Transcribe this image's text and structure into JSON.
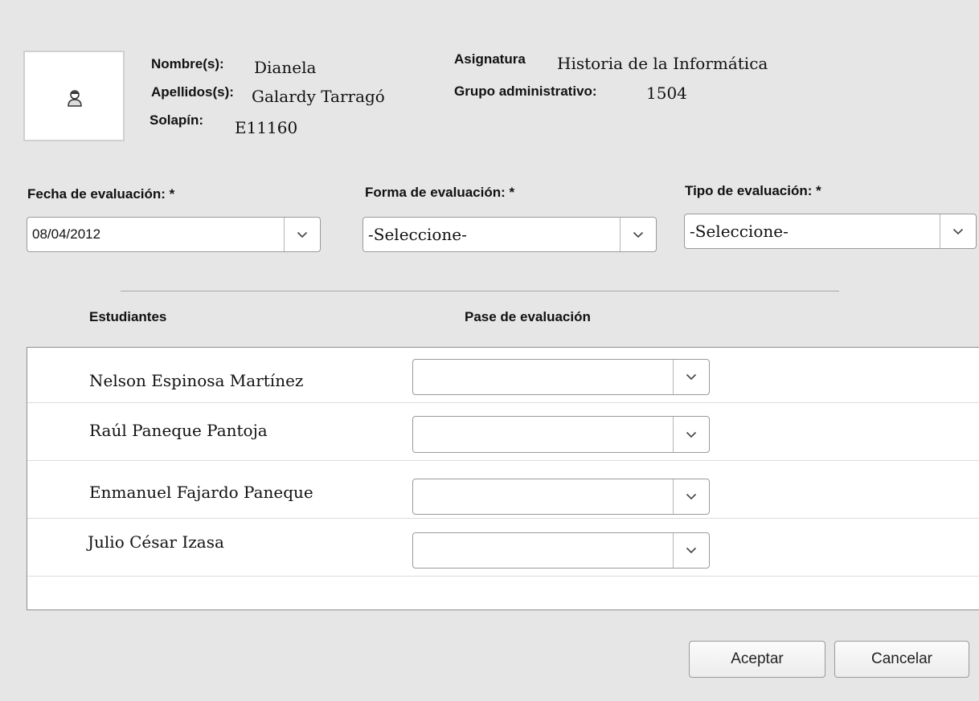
{
  "student": {
    "name_label": "Nombre(s):",
    "name": "Dianela",
    "surname_label": "Apellidos(s):",
    "surname": "Galardy Tarragó",
    "badge_label": "Solapín:",
    "badge": "E11160",
    "avatar_icon": "user-icon"
  },
  "course": {
    "subject_label": "Asignatura",
    "subject": "Historia de la Informática",
    "group_label": "Grupo administrativo:",
    "group": "1504"
  },
  "form": {
    "date_label": "Fecha de evaluación: *",
    "date_value": "08/04/2012",
    "form_label": "Forma de evaluación: *",
    "form_value": "-Seleccione-",
    "type_label": "Tipo de evaluación: *",
    "type_value": "-Seleccione-"
  },
  "table": {
    "col_students": "Estudiantes",
    "col_pass": "Pase de evaluación",
    "rows": [
      {
        "name": "Nelson Espinosa Martínez",
        "pass": ""
      },
      {
        "name": "Raúl Paneque Pantoja",
        "pass": ""
      },
      {
        "name": "Enmanuel Fajardo Paneque",
        "pass": ""
      },
      {
        "name": "Julio César Izasa",
        "pass": ""
      }
    ]
  },
  "actions": {
    "accept": "Aceptar",
    "cancel": "Cancelar"
  }
}
